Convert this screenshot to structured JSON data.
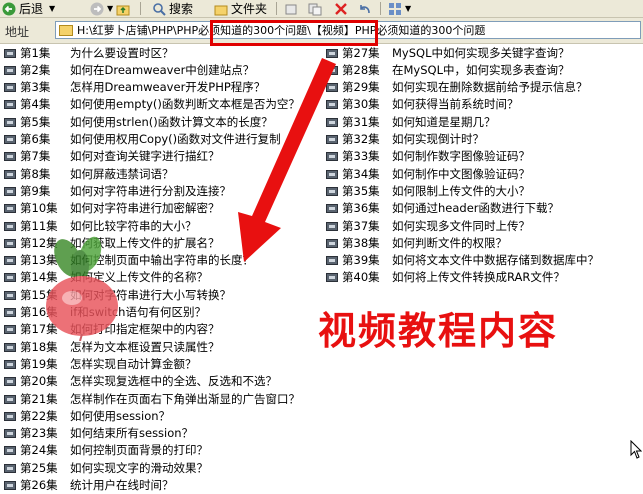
{
  "toolbar": {
    "back_label": "后退",
    "search_label": "搜索",
    "folders_label": "文件夹"
  },
  "address": {
    "label": "地址",
    "path": "H:\\红萝卜店铺\\PHP\\PHP必须知道的300个问题\\【视频】PHP必须知道的300个问题"
  },
  "left_column": [
    {
      "ep": "第1集",
      "title": "为什么要设置时区？"
    },
    {
      "ep": "第2集",
      "title": "如何在Dreamweaver中创建站点？"
    },
    {
      "ep": "第3集",
      "title": "怎样用Dreamweaver开发PHP程序？"
    },
    {
      "ep": "第4集",
      "title": "如何使用empty()函数判断文本框是否为空？"
    },
    {
      "ep": "第5集",
      "title": "如何使用strlen()函数计算文本的长度？"
    },
    {
      "ep": "第6集",
      "title": "如何使用权用Copy()函数对文件进行复制"
    },
    {
      "ep": "第7集",
      "title": "如何对查询关键字进行描红？"
    },
    {
      "ep": "第8集",
      "title": "如何屏蔽违禁词语？"
    },
    {
      "ep": "第9集",
      "title": "如何对字符串进行分割及连接？"
    },
    {
      "ep": "第10集",
      "title": "如何对字符串进行加密解密？"
    },
    {
      "ep": "第11集",
      "title": "如何比较字符串的大小？"
    },
    {
      "ep": "第12集",
      "title": "如何获取上传文件的扩展名？"
    },
    {
      "ep": "第13集",
      "title": "如何控制页面中输出字符串的长度？"
    },
    {
      "ep": "第14集",
      "title": "如何定义上传文件的名称？"
    },
    {
      "ep": "第15集",
      "title": "如何对字符串进行大小写转换？"
    },
    {
      "ep": "第16集",
      "title": "if和switch语句有何区别？"
    },
    {
      "ep": "第17集",
      "title": "如何打印指定框架中的内容？"
    },
    {
      "ep": "第18集",
      "title": "怎样为文本框设置只读属性？"
    },
    {
      "ep": "第19集",
      "title": "怎样实现自动计算金额？"
    },
    {
      "ep": "第20集",
      "title": "怎样实现复选框中的全选、反选和不选？"
    },
    {
      "ep": "第21集",
      "title": "怎样制作在页面右下角弹出渐显的广告窗口？"
    },
    {
      "ep": "第22集",
      "title": "如何使用session？"
    },
    {
      "ep": "第23集",
      "title": "如何结束所有session？"
    },
    {
      "ep": "第24集",
      "title": "如何控制页面背景的打印？"
    },
    {
      "ep": "第25集",
      "title": "如何实现文字的滑动效果？"
    },
    {
      "ep": "第26集",
      "title": "统计用户在线时间？"
    }
  ],
  "right_column": [
    {
      "ep": "第27集",
      "title": "MySQL中如何实现多关键字查询？"
    },
    {
      "ep": "第28集",
      "title": "在MySQL中，如何实现多表查询？"
    },
    {
      "ep": "第29集",
      "title": "如何实现在删除数据前给予提示信息？"
    },
    {
      "ep": "第30集",
      "title": "如何获得当前系统时间？"
    },
    {
      "ep": "第31集",
      "title": "如何知道是星期几？"
    },
    {
      "ep": "第32集",
      "title": "如何实现倒计时？"
    },
    {
      "ep": "第33集",
      "title": "如何制作数字图像验证码？"
    },
    {
      "ep": "第34集",
      "title": "如何制作中文图像验证码？"
    },
    {
      "ep": "第35集",
      "title": "如何限制上传文件的大小？"
    },
    {
      "ep": "第36集",
      "title": "如何通过header函数进行下载？"
    },
    {
      "ep": "第37集",
      "title": "如何实现多文件同时上传？"
    },
    {
      "ep": "第38集",
      "title": "如何判断文件的权限？"
    },
    {
      "ep": "第39集",
      "title": "如何将文本文件中数据存储到数据库中？"
    },
    {
      "ep": "第40集",
      "title": "如何将上传文件转换成RAR文件？"
    }
  ],
  "overlay": {
    "caption": "视频教程内容"
  },
  "colors": {
    "accent_red": "#e00000",
    "chrome_bg": "#ece9d8"
  }
}
